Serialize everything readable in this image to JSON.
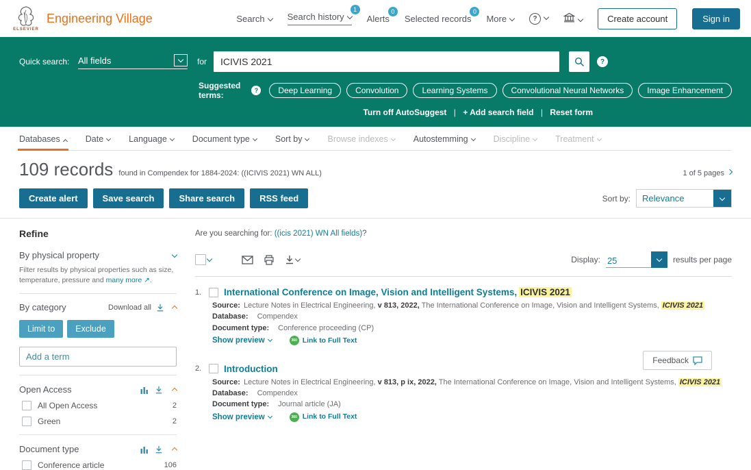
{
  "brand": {
    "logo_caption": "ELSEVIER",
    "name": "Engineering Village"
  },
  "header_nav": {
    "search": "Search",
    "search_history": "Search history",
    "search_history_badge": "1",
    "alerts": "Alerts",
    "alerts_badge": "0",
    "selected_records": "Selected records",
    "selected_records_badge": "0",
    "more": "More",
    "help": "?",
    "create_account": "Create account",
    "sign_in": "Sign in"
  },
  "quick_search": {
    "label": "Quick search:",
    "field_select_value": "All fields",
    "for_label": "for",
    "query_value": "ICIVIS 2021",
    "suggested_terms_label": "Suggested terms:",
    "help_glyph": "?",
    "suggested_terms": [
      "Deep Learning",
      "Convolution",
      "Learning Systems",
      "Convolutional Neural Networks",
      "Image Enhancement"
    ],
    "turn_off_autosuggest": "Turn off AutoSuggest",
    "separator": "|",
    "add_search_field": "+ Add search field",
    "reset_form": "Reset form"
  },
  "filter_bar": {
    "tabs": [
      {
        "label": "Databases",
        "state": "active"
      },
      {
        "label": "Date",
        "state": "default"
      },
      {
        "label": "Language",
        "state": "default"
      },
      {
        "label": "Document type",
        "state": "default"
      },
      {
        "label": "Sort by",
        "state": "default"
      },
      {
        "label": "Browse indexes",
        "state": "disabled"
      },
      {
        "label": "Autostemming",
        "state": "default"
      },
      {
        "label": "Discipline",
        "state": "disabled"
      },
      {
        "label": "Treatment",
        "state": "disabled"
      }
    ]
  },
  "results_summary": {
    "count": "109 records",
    "detail": "found in Compendex for 1884-2024: ((ICIVIS 2021) WN ALL)",
    "pagination": "1 of 5 pages",
    "create_alert": "Create alert",
    "save_search": "Save search",
    "share_search": "Share search",
    "rss_feed": "RSS feed",
    "sort_by_label": "Sort by:",
    "sort_by_value": "Relevance"
  },
  "refine_panel": {
    "title": "Refine",
    "by_physical_property": "By physical property",
    "physical_property_desc": "Filter results by physical properties such as size, temperature, pressure and",
    "physical_property_link": "many more ↗",
    "physical_property_desc_end": ".",
    "by_category": "By category",
    "download_all": "Download all",
    "limit_to": "Limit to",
    "exclude": "Exclude",
    "add_term_placeholder": "Add a term",
    "open_access": {
      "title": "Open Access",
      "items": [
        {
          "label": "All Open Access",
          "count": "2"
        },
        {
          "label": "Green",
          "count": "2"
        }
      ]
    },
    "document_type": {
      "title": "Document type",
      "items": [
        {
          "label": "Conference article",
          "count": "106"
        }
      ]
    }
  },
  "results": {
    "searching_for_label": "Are you searching for:",
    "searching_for_link": "((icis 2021) WN All fields)",
    "searching_for_suffix": "?",
    "display_label": "Display:",
    "display_value": "25",
    "display_suffix": "results per page",
    "items": [
      {
        "number": "1.",
        "title": "International Conference on Image, Vision and Intelligent Systems,",
        "title_highlight": "ICIVIS 2021",
        "source_label": "Source:",
        "source_text": "Lecture Notes in Electrical Engineering,",
        "source_bold": "v 813, 2022,",
        "source_text2": "The International Conference on Image, Vision and Intelligent Systems,",
        "source_highlight": "ICIVIS 2021",
        "database_label": "Database:",
        "database_value": "Compendex",
        "doctype_label": "Document type:",
        "doctype_value": "Conference proceeding (CP)",
        "show_preview": "Show preview",
        "full_text_badge": "360",
        "full_text_label": "Link to Full Text"
      },
      {
        "number": "2.",
        "title": "Introduction",
        "source_label": "Source:",
        "source_text": "Lecture Notes in Electrical Engineering,",
        "source_bold": "v 813, p ix, 2022,",
        "source_text2": "The International Conference on Image, Vision and Intelligent Systems,",
        "source_highlight": "ICIVIS 2021",
        "database_label": "Database:",
        "database_value": "Compendex",
        "doctype_label": "Document type:",
        "doctype_value": "Journal article (JA)",
        "show_preview": "Show preview",
        "full_text_badge": "360",
        "full_text_label": "Link to Full Text"
      }
    ],
    "feedback": "Feedback"
  },
  "colors": {
    "brand_green": "#077a68",
    "button_teal": "#186e90",
    "link_teal": "#0e7e96",
    "accent_orange": "#e9711c",
    "badge_blue": "#3ba6c9",
    "highlight_yellow": "#fbf3a0"
  },
  "icons": {
    "elsevier_tree": "tree-logo",
    "search": "magnifier",
    "institution": "bank-building",
    "email": "envelope",
    "print": "printer",
    "download": "arrow-down-tray",
    "histogram": "bar-chart",
    "feedback": "speech-bubble"
  }
}
